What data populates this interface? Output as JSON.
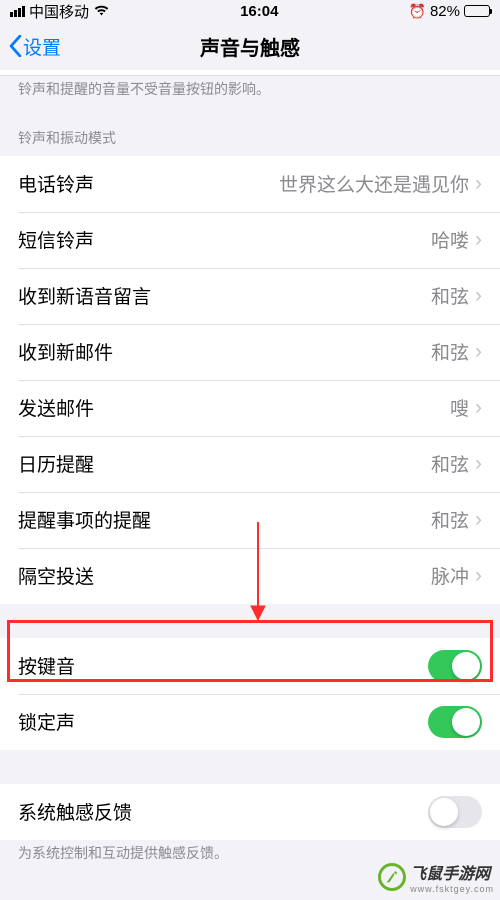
{
  "status": {
    "carrier": "中国移动",
    "time": "16:04",
    "battery_pct": "82%"
  },
  "nav": {
    "back": "设置",
    "title": "声音与触感"
  },
  "notes": {
    "top": "铃声和提醒的音量不受音量按钮的影响。",
    "haptic": "为系统控制和互动提供触感反馈。"
  },
  "sections": {
    "ringtone_header": "铃声和振动模式"
  },
  "rows": {
    "ringtone": {
      "label": "电话铃声",
      "value": "世界这么大还是遇见你"
    },
    "text": {
      "label": "短信铃声",
      "value": "哈喽"
    },
    "voicemail": {
      "label": "收到新语音留言",
      "value": "和弦"
    },
    "mail": {
      "label": "收到新邮件",
      "value": "和弦"
    },
    "sent": {
      "label": "发送邮件",
      "value": "嗖"
    },
    "calendar": {
      "label": "日历提醒",
      "value": "和弦"
    },
    "reminder": {
      "label": "提醒事项的提醒",
      "value": "和弦"
    },
    "airdrop": {
      "label": "隔空投送",
      "value": "脉冲"
    },
    "keyclick": {
      "label": "按键音"
    },
    "lock": {
      "label": "锁定声"
    },
    "haptic": {
      "label": "系统触感反馈"
    }
  },
  "toggles": {
    "keyclick": true,
    "lock": true,
    "haptic": false
  },
  "watermark": {
    "name": "飞鼠手游网",
    "sub": "www.fsktgey.com"
  }
}
